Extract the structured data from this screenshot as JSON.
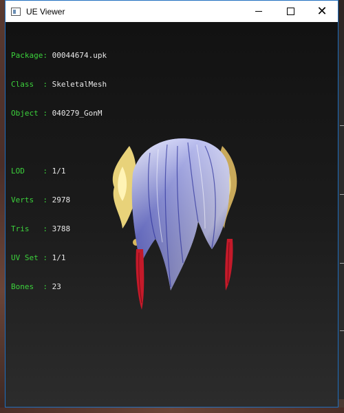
{
  "window": {
    "title": "UE Viewer",
    "controls": {
      "minimize": "",
      "maximize": "",
      "close": "✕"
    }
  },
  "info_block": {
    "group1": [
      {
        "label": "Package: ",
        "value": "00044674.upk"
      },
      {
        "label": "Class  : ",
        "value": "SkeletalMesh"
      },
      {
        "label": "Object : ",
        "value": "040279_GonM"
      }
    ],
    "group2": [
      {
        "label": "LOD    : ",
        "value": "1/1"
      },
      {
        "label": "Verts  : ",
        "value": "2978"
      },
      {
        "label": "Tris   : ",
        "value": "3788"
      },
      {
        "label": "UV Set : ",
        "value": "1/1"
      },
      {
        "label": "Bones  : ",
        "value": "23"
      }
    ]
  },
  "colors": {
    "label_green": "#3cd33c",
    "value_white": "#e8e8e8",
    "hair_blue": "#5a63d8",
    "ornament_gold": "#e8d27a",
    "tassel_red": "#c41a2a"
  }
}
